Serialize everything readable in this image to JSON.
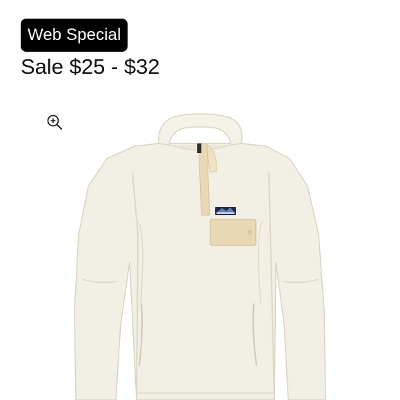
{
  "badge": {
    "label": "Web Special"
  },
  "pricing": {
    "text": "Sale $25 - $32"
  },
  "icons": {
    "zoom": "zoom-in-icon"
  },
  "product": {
    "logo_text": "Patagonia",
    "colors": {
      "fleece": "#f2efe4",
      "fleece_shadow": "#e2ddcd",
      "placket": "#e9d8b4",
      "logo": "#1f2d4d"
    }
  }
}
